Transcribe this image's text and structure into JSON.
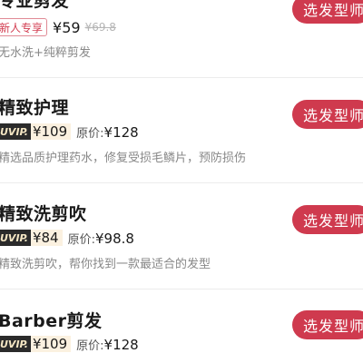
{
  "items": [
    {
      "title": "专业剪发",
      "badge": "新人专享",
      "price": "¥59",
      "strike_price": "¥69.8",
      "desc": "无水洗+纯粹剪发",
      "button": "选发型师"
    },
    {
      "title": "精致护理",
      "vip_tag": "UVIP.",
      "vip_price": "¥109",
      "orig_label": "原价:",
      "orig_price": "¥128",
      "desc": "精选品质护理药水，修复受损毛鳞片，预防损伤",
      "button": "选发型师"
    },
    {
      "title": "精致洗剪吹",
      "vip_tag": "UVIP.",
      "vip_price": "¥84",
      "orig_label": "原价:",
      "orig_price": "¥98.8",
      "desc": "精致洗剪吹，帮你找到一款最适合的发型",
      "button": "选发型师"
    },
    {
      "title": "Barber剪发",
      "vip_tag": "UVIP.",
      "vip_price": "¥109",
      "orig_label": "原价:",
      "orig_price": "¥128",
      "button": "选发型师"
    }
  ],
  "colors": {
    "accent": "#cf3a4e",
    "vip_dark": "#2b2b2b",
    "vip_light": "#fbf1e0"
  }
}
